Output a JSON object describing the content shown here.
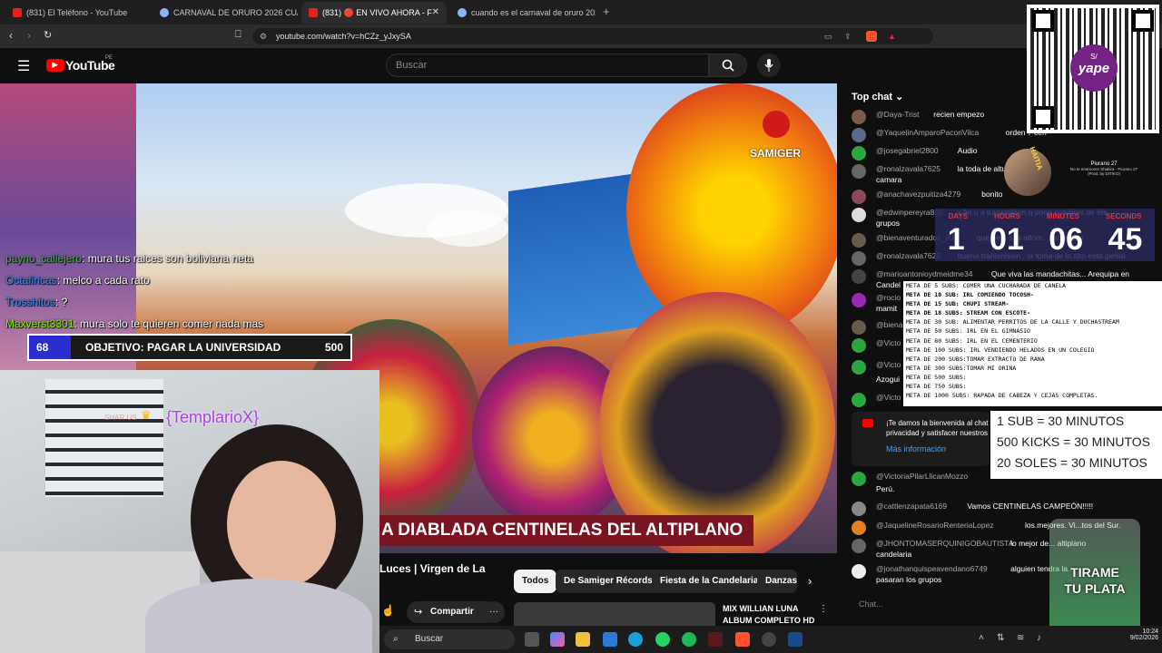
{
  "browser": {
    "tabs": [
      {
        "label": "(831) El Teléfono - YouTube",
        "color": "#e62117"
      },
      {
        "label": "CARNAVAL DE ORURO 2026 CUANDO",
        "color": "#8ab4f8"
      },
      {
        "label": "(831) 🔴 EN VIVO AHORA - F",
        "color": "#e62117"
      },
      {
        "label": "cuando es el carnaval de oruro 2026",
        "color": "#8ab4f8"
      }
    ],
    "new_tab": "+",
    "url": "youtube.com/watch?v=hCZz_yJxySA"
  },
  "youtube": {
    "logo": "YouTube",
    "country": "PE",
    "search_placeholder": "Buscar"
  },
  "video": {
    "title_banner": "A DIABLADA CENTINELAS DEL ALTIPLANO",
    "watermark": "SAMIGER",
    "title_partial": "Luces | Virgen de La",
    "share_label": "Compartir",
    "more_label": "···"
  },
  "overlay_chat": [
    {
      "user": "payno_callejero",
      "text": ": mura tus raices son boliviana neta",
      "color": "#4caf50"
    },
    {
      "user": "Octafiricas",
      "text": ": melco a cada rato",
      "color": "#2a8dff"
    },
    {
      "user": "Trosshitos",
      "text": ": ?",
      "color": "#2a8dff"
    },
    {
      "user": "Maxverst3301",
      "text": ": mura solo te quieren comer nada mas",
      "color": "#7cfc00"
    }
  ],
  "goal": {
    "current": "68",
    "label": "OBJETIVO: PAGAR LA UNIVERSIDAD",
    "target": "500"
  },
  "webcam": {
    "alert_prefix": "SHAR US",
    "alert_name": "{TemplarioX}"
  },
  "chips": [
    "Todos",
    "De Samiger Récords",
    "Fiesta de la Candelaria",
    "Danzas"
  ],
  "related": {
    "title1": "MIX WILLIAN LUNA",
    "title2": "ALBUM COMPLETO HD"
  },
  "live_chat": {
    "header": "Top chat",
    "messages": [
      {
        "user": "@Daya-Trist",
        "text": "recien empezo",
        "color": "#7b5a4a"
      },
      {
        "user": "@YaquelinAmparoPacoriVilca",
        "text": "orden 7 cen",
        "color": "#5a6b8a"
      },
      {
        "user": "@josegabriel2800",
        "text": "Audio",
        "color": "#2ba640"
      },
      {
        "user": "@ronalzavala7625",
        "text": "la toda de altur",
        "color": "#666"
      },
      {
        "user": "",
        "text": "camara",
        "color": ""
      },
      {
        "user": "@anachavezpuitiza4279",
        "text": "bonito",
        "color": "#8a4a5a"
      },
      {
        "user": "@edwinpereyra855",
        "text": "x fin u a transmision q pone nombres de los",
        "color": "#ddd"
      },
      {
        "user": "",
        "text": "grupos",
        "color": ""
      },
      {
        "user": "@bienaventurados_202",
        "text": "qué he... ssa alfom... ordenado",
        "color": "#6a5a4a"
      },
      {
        "user": "@ronalzavala7625",
        "text": "buena transmision , la toma de lo alto esta genial",
        "color": "#666"
      },
      {
        "user": "@marioantonioydmeidme34",
        "text": "Que viva las mandachitas... Arequipa en",
        "color": "#444"
      },
      {
        "user": "",
        "text": "Candel",
        "color": ""
      },
      {
        "user": "@rocio",
        "text": "",
        "color": "#9c27b0"
      },
      {
        "user": "",
        "text": "mamit",
        "color": ""
      },
      {
        "user": "@biena",
        "text": "",
        "color": "#6a5a4a"
      },
      {
        "user": "@Victo",
        "text": "",
        "color": "#2ba640"
      },
      {
        "user": "@Victo",
        "text": "",
        "color": "#2ba640"
      },
      {
        "user": "",
        "text": "Azogui",
        "color": ""
      },
      {
        "user": "@Victo",
        "text": "",
        "color": "#2ba640"
      }
    ],
    "welcome": "¡Te damos la bienvenida al chat",
    "welcome2": "privacidad y satisfacer nuestros",
    "more_info": "Más información",
    "messages_after": [
      {
        "user": "@VictoriaPilarLlicanMozzo",
        "text": "",
        "color": "#2ba640"
      },
      {
        "user": "",
        "text": "Perú.",
        "color": ""
      },
      {
        "user": "@cattlenzapata6169",
        "text": "Vamos CENTINELAS CAMPEÓN!!!!!",
        "color": "#888"
      },
      {
        "user": "@JaquelineRosarioRenteriaLopez",
        "text": "los.mejores. Vi...tos del Sur.",
        "color": "#e67e22"
      },
      {
        "user": "@JHONTOMASERQUINIGOBAUTISTA",
        "text": "lo mejor de... altiplano",
        "color": "#666"
      },
      {
        "user": "",
        "text": "candelaria",
        "color": ""
      },
      {
        "user": "@jonathanquispeavendano6749",
        "text": "alguien tendra la...",
        "color": "#eee"
      },
      {
        "user": "",
        "text": "pasaran los grupos",
        "color": ""
      }
    ],
    "input_placeholder": "Chat..."
  },
  "countdown": {
    "labels": [
      "DAYS",
      "HOURS",
      "MINUTES",
      "SECONDS"
    ],
    "values": [
      "1",
      "01",
      "06",
      "45"
    ]
  },
  "now_playing": {
    "title": "Piurano 27",
    "sub": "No te enamores Shakira - Piurano 27",
    "sub2": "(Prod. by DITIKO)",
    "badge": "HAITIA"
  },
  "metas": [
    "META DE 5 SUBS: COMER UNA CUCHARADA DE CANELA",
    "META DE 10 SUB: IRL COMIENDO TOCOSH-",
    "META DE 15 SUB: CHUPI STREAM-",
    "META DE 18 SUBS: STREAM CON ESCOTE-",
    "META DE 30 SUB:  ALIMENTAR PERRITOS DE LA CALLE Y DUCHASTREAM",
    "META DE 50 SUBS: IRL EN EL GIMNASIO",
    "META DE 80 SUBS: IRL EN EL CEMENTERIO",
    "META DE 100 SUBS: IRL VENDIENDO HELADOS EN UN COLEGIO",
    "META DE 200 SUBS:TOMAR EXTRACTO DE RANA",
    "META DE 300 SUBS:TOMAR MI ORINA",
    "META DE 500 SUBS:",
    "META DE 750 SUBS:",
    "META DE 1000 SUBS: RAPADA DE CABEZA Y CEJAS COMPLETAS."
  ],
  "rates": [
    "1 SUB = 30 MINUTOS",
    "500 KICKS = 30 MINUTOS",
    "20 SOLES = 30 MINUTOS"
  ],
  "qr": {
    "brand": "yape",
    "tag": "S/"
  },
  "tirame": {
    "line1": "TIRAME",
    "line2": "TU PLATA"
  },
  "taskbar": {
    "search": "Buscar",
    "time": "10:24",
    "date": "9/02/2026"
  }
}
